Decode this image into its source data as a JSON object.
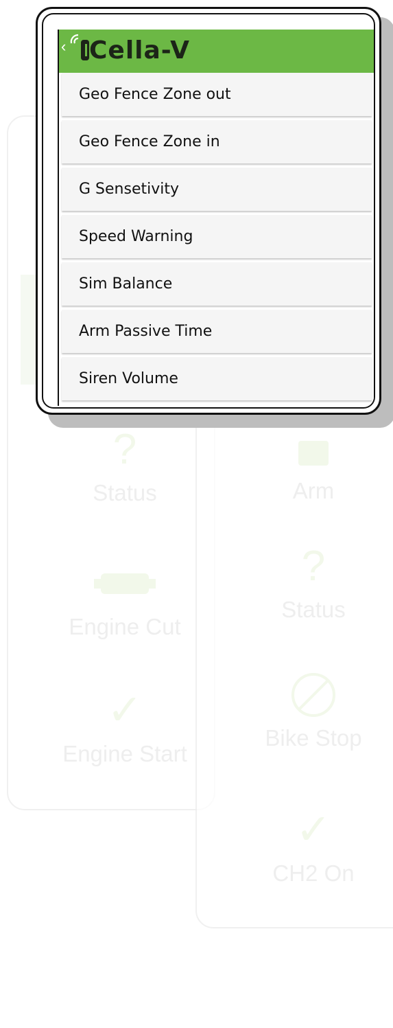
{
  "colors": {
    "header_green": "#6cb845",
    "logo_dark": "#1c2418",
    "menu_item_bg": "#f5f5f5",
    "frame_border": "#111111",
    "faded_green": "#eef6e4",
    "faded_text": "#e9e9e9"
  },
  "dialog": {
    "app_title": "Cella-V",
    "back_icon": "chevron-left",
    "logo_icon": "signal-waves",
    "menu_items": [
      {
        "label": "Geo Fence Zone out"
      },
      {
        "label": "Geo Fence Zone in"
      },
      {
        "label": "G Sensetivity"
      },
      {
        "label": "Speed Warning"
      },
      {
        "label": "Sim Balance"
      },
      {
        "label": "Arm Passive Time"
      },
      {
        "label": "Siren Volume"
      }
    ]
  },
  "background": {
    "left_card": {
      "items": [
        {
          "label": "Status",
          "icon": "question-mark"
        },
        {
          "label": "Engine Cut",
          "icon": "engine"
        },
        {
          "label": "Engine Start",
          "icon": "checkmark"
        }
      ]
    },
    "right_card": {
      "items": [
        {
          "label": "Arm",
          "icon": "lock"
        },
        {
          "label": "Status",
          "icon": "question-mark"
        },
        {
          "label": "Bike Stop",
          "icon": "no-entry"
        },
        {
          "label": "CH2 On",
          "icon": "checkmark"
        }
      ]
    }
  }
}
